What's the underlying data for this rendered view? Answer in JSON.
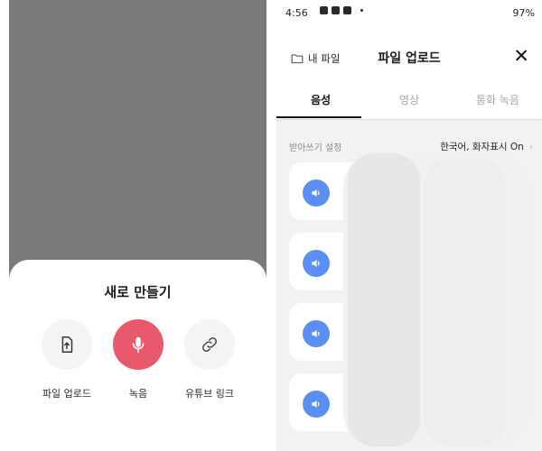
{
  "left": {
    "sheet_title": "새로 만들기",
    "actions": [
      {
        "label": "파일 업로드",
        "icon": "file-upload-icon"
      },
      {
        "label": "녹음",
        "icon": "microphone-icon"
      },
      {
        "label": "유튜브 링크",
        "icon": "link-icon"
      }
    ],
    "record_color": "#e85a6b",
    "overlay_color": "#7a7a7a"
  },
  "right": {
    "status": {
      "time": "4:56",
      "right": "97%"
    },
    "header": {
      "my_files": "내 파일",
      "title": "파일 업로드",
      "close": "✕"
    },
    "tabs": [
      {
        "label": "음성",
        "active": true
      },
      {
        "label": "영상",
        "active": false
      },
      {
        "label": "통화 녹음",
        "active": false
      }
    ],
    "transcription_setting": {
      "label": "받아쓰기 설정",
      "value": "한국어, 화자표시 On"
    },
    "cards_count": 4,
    "speaker_color": "#5b8ff3"
  }
}
